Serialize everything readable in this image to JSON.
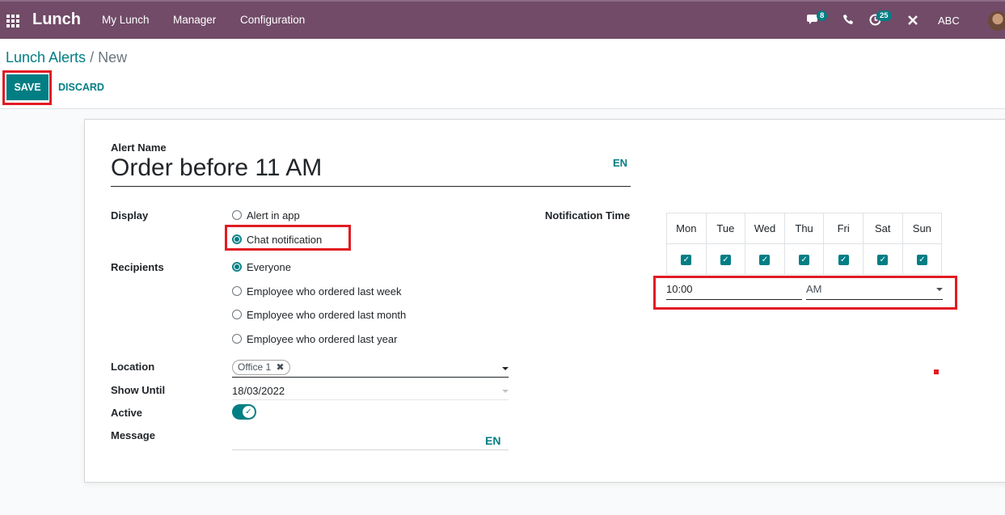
{
  "navbar": {
    "brand": "Lunch",
    "menu": [
      "My Lunch",
      "Manager",
      "Configuration"
    ],
    "messages_badge": "8",
    "activities_badge": "25",
    "company": "ABC"
  },
  "breadcrumb": {
    "parent": "Lunch Alerts",
    "separator": "/",
    "current": "New"
  },
  "buttons": {
    "save": "SAVE",
    "discard": "DISCARD"
  },
  "form": {
    "alert_name_label": "Alert Name",
    "alert_name_value": "Order before 11 AM",
    "lang": "EN",
    "display_label": "Display",
    "display_options": [
      "Alert in app",
      "Chat notification"
    ],
    "display_selected": "Chat notification",
    "recipients_label": "Recipients",
    "recipients_options": [
      "Everyone",
      "Employee who ordered last week",
      "Employee who ordered last month",
      "Employee who ordered last year"
    ],
    "recipients_selected": "Everyone",
    "location_label": "Location",
    "location_tag": "Office 1",
    "show_until_label": "Show Until",
    "show_until_value": "18/03/2022",
    "active_label": "Active",
    "active": true,
    "message_label": "Message",
    "message_lang": "EN",
    "notification_time_label": "Notification Time",
    "days": [
      "Mon",
      "Tue",
      "Wed",
      "Thu",
      "Fri",
      "Sat",
      "Sun"
    ],
    "days_checked": [
      true,
      true,
      true,
      true,
      true,
      true,
      true
    ],
    "time_value": "10:00",
    "ampm_value": "AM"
  },
  "colors": {
    "navbar": "#714b67",
    "accent": "#017e84",
    "highlight": "#e21b23"
  }
}
